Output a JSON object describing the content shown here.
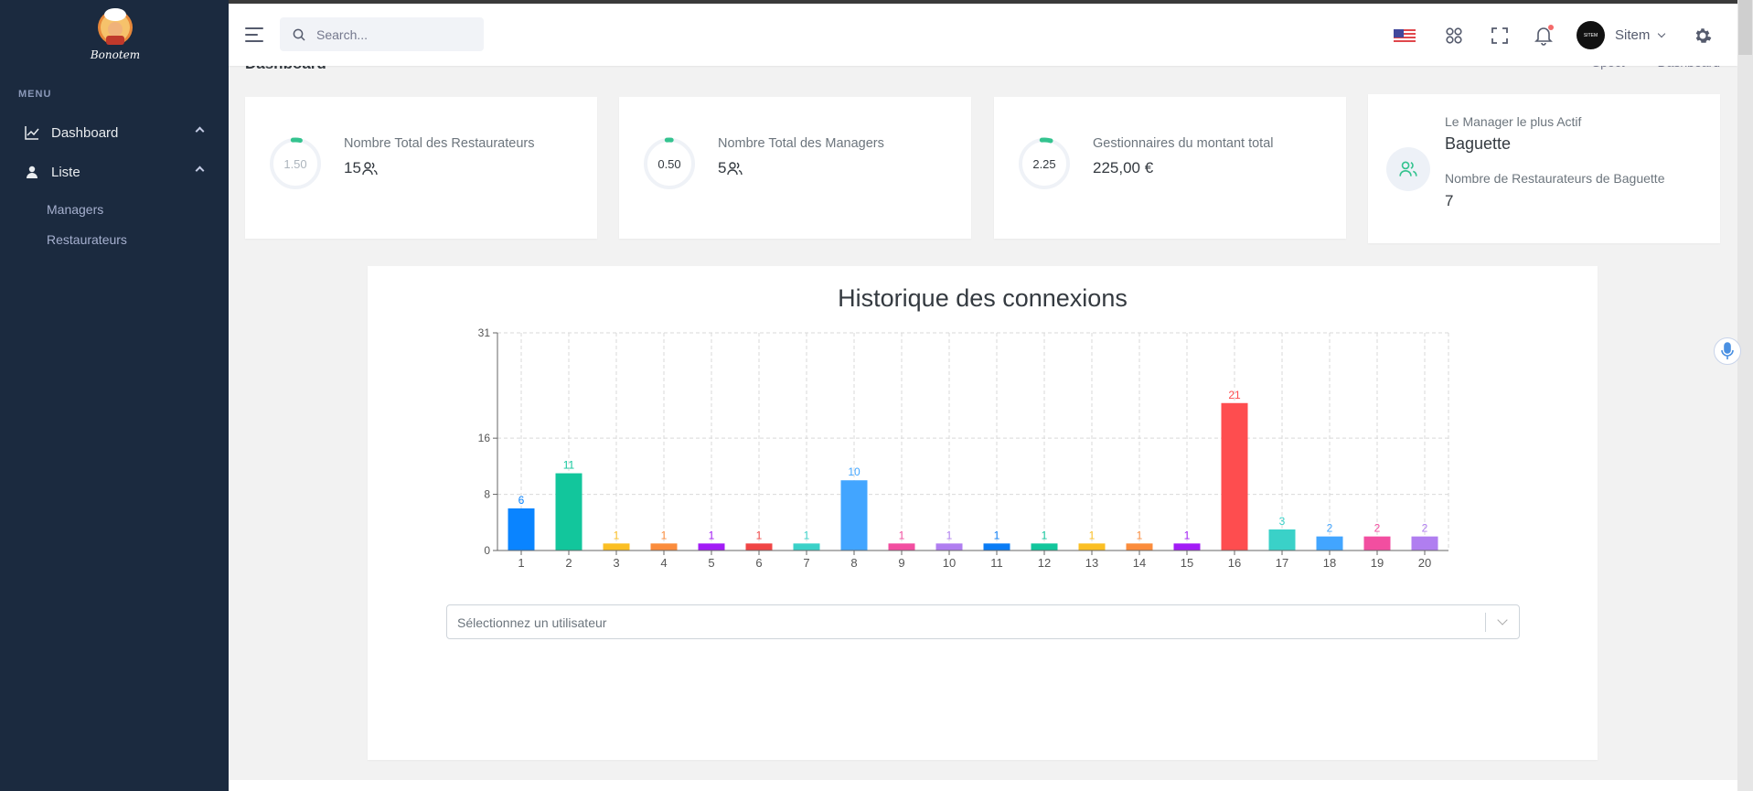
{
  "brand": {
    "logo_text": "Bonotem"
  },
  "sidebar": {
    "menu_title": "MENU",
    "items": [
      {
        "label": "Dashboard",
        "icon": "chart-line-icon"
      },
      {
        "label": "Liste",
        "icon": "user-icon"
      }
    ],
    "sub_items": [
      "Managers",
      "Restaurateurs"
    ]
  },
  "topbar": {
    "search_placeholder": "Search...",
    "user_name": "Sitem",
    "avatar_text": "SITEM"
  },
  "page": {
    "title": "Dashboard",
    "breadcrumbs": [
      "Spect",
      "Dashboard"
    ]
  },
  "stats": [
    {
      "ring_value": "1.50",
      "label": "Nombre Total des Restaurateurs",
      "value": "15",
      "progress": 0.05
    },
    {
      "ring_value": "0.50",
      "label": "Nombre Total des Managers",
      "value": "5",
      "progress": 0.03
    },
    {
      "ring_value": "2.25",
      "label": "Gestionnaires du montant total",
      "value": "225,00 €",
      "progress": 0.06
    }
  ],
  "manager_card": {
    "label1": "Le Manager le plus Actif",
    "value1": "Baguette",
    "label2": "Nombre de Restaurateurs de Baguette",
    "value2": "7"
  },
  "select": {
    "placeholder": "Sélectionnez un utilisateur"
  },
  "colors": {
    "sidebar_bg": "#1b2a3f",
    "accent_teal": "#34c38f",
    "palette": [
      "#0a84ff",
      "#12c69c",
      "#fbbf24",
      "#fb8c3c",
      "#a21cf6",
      "#f04545",
      "#3ad1c8",
      "#42a5ff",
      "#f24ea0",
      "#b07ef0",
      "#0a7cf5",
      "#12c69c",
      "#fbbf24",
      "#fb8c3c",
      "#a21cf6",
      "#fe4d4f",
      "#3ad1c8",
      "#42a5ff",
      "#f24ea0",
      "#b07ef0"
    ]
  },
  "chart_data": {
    "type": "bar",
    "title": "Historique des connexions",
    "categories": [
      "1",
      "2",
      "3",
      "4",
      "5",
      "6",
      "7",
      "8",
      "9",
      "10",
      "11",
      "12",
      "13",
      "14",
      "15",
      "16",
      "17",
      "18",
      "19",
      "20"
    ],
    "values": [
      6,
      11,
      1,
      1,
      1,
      1,
      1,
      10,
      1,
      1,
      1,
      1,
      1,
      1,
      1,
      21,
      3,
      2,
      2,
      2
    ],
    "yticks": [
      0,
      8,
      16,
      31
    ],
    "ylim": [
      0,
      31
    ],
    "grid": true,
    "data_labels": true
  }
}
